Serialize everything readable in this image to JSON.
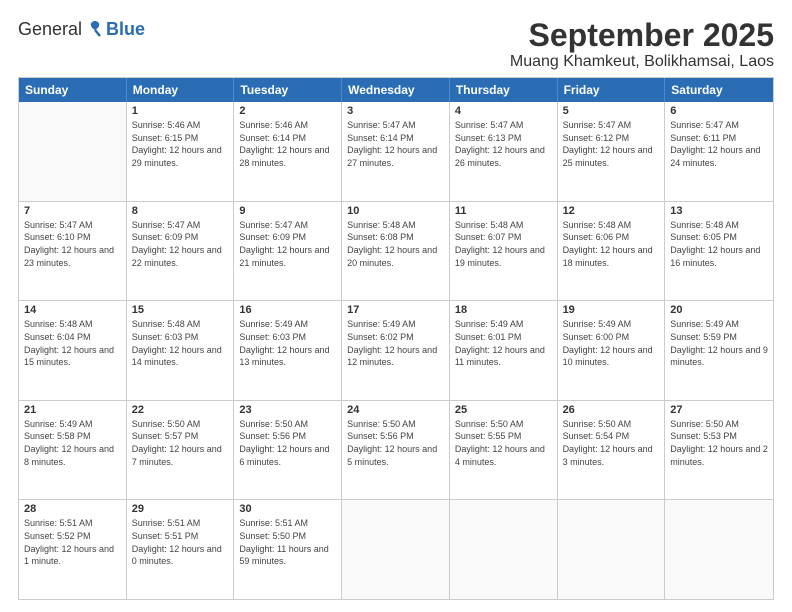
{
  "app": {
    "logo_general": "General",
    "logo_blue": "Blue"
  },
  "title": "September 2025",
  "subtitle": "Muang Khamkeut, Bolikhamsai, Laos",
  "days": [
    "Sunday",
    "Monday",
    "Tuesday",
    "Wednesday",
    "Thursday",
    "Friday",
    "Saturday"
  ],
  "weeks": [
    [
      {
        "day": "",
        "sunrise": "",
        "sunset": "",
        "daylight": ""
      },
      {
        "day": "1",
        "sunrise": "Sunrise: 5:46 AM",
        "sunset": "Sunset: 6:15 PM",
        "daylight": "Daylight: 12 hours and 29 minutes."
      },
      {
        "day": "2",
        "sunrise": "Sunrise: 5:46 AM",
        "sunset": "Sunset: 6:14 PM",
        "daylight": "Daylight: 12 hours and 28 minutes."
      },
      {
        "day": "3",
        "sunrise": "Sunrise: 5:47 AM",
        "sunset": "Sunset: 6:14 PM",
        "daylight": "Daylight: 12 hours and 27 minutes."
      },
      {
        "day": "4",
        "sunrise": "Sunrise: 5:47 AM",
        "sunset": "Sunset: 6:13 PM",
        "daylight": "Daylight: 12 hours and 26 minutes."
      },
      {
        "day": "5",
        "sunrise": "Sunrise: 5:47 AM",
        "sunset": "Sunset: 6:12 PM",
        "daylight": "Daylight: 12 hours and 25 minutes."
      },
      {
        "day": "6",
        "sunrise": "Sunrise: 5:47 AM",
        "sunset": "Sunset: 6:11 PM",
        "daylight": "Daylight: 12 hours and 24 minutes."
      }
    ],
    [
      {
        "day": "7",
        "sunrise": "Sunrise: 5:47 AM",
        "sunset": "Sunset: 6:10 PM",
        "daylight": "Daylight: 12 hours and 23 minutes."
      },
      {
        "day": "8",
        "sunrise": "Sunrise: 5:47 AM",
        "sunset": "Sunset: 6:09 PM",
        "daylight": "Daylight: 12 hours and 22 minutes."
      },
      {
        "day": "9",
        "sunrise": "Sunrise: 5:47 AM",
        "sunset": "Sunset: 6:09 PM",
        "daylight": "Daylight: 12 hours and 21 minutes."
      },
      {
        "day": "10",
        "sunrise": "Sunrise: 5:48 AM",
        "sunset": "Sunset: 6:08 PM",
        "daylight": "Daylight: 12 hours and 20 minutes."
      },
      {
        "day": "11",
        "sunrise": "Sunrise: 5:48 AM",
        "sunset": "Sunset: 6:07 PM",
        "daylight": "Daylight: 12 hours and 19 minutes."
      },
      {
        "day": "12",
        "sunrise": "Sunrise: 5:48 AM",
        "sunset": "Sunset: 6:06 PM",
        "daylight": "Daylight: 12 hours and 18 minutes."
      },
      {
        "day": "13",
        "sunrise": "Sunrise: 5:48 AM",
        "sunset": "Sunset: 6:05 PM",
        "daylight": "Daylight: 12 hours and 16 minutes."
      }
    ],
    [
      {
        "day": "14",
        "sunrise": "Sunrise: 5:48 AM",
        "sunset": "Sunset: 6:04 PM",
        "daylight": "Daylight: 12 hours and 15 minutes."
      },
      {
        "day": "15",
        "sunrise": "Sunrise: 5:48 AM",
        "sunset": "Sunset: 6:03 PM",
        "daylight": "Daylight: 12 hours and 14 minutes."
      },
      {
        "day": "16",
        "sunrise": "Sunrise: 5:49 AM",
        "sunset": "Sunset: 6:03 PM",
        "daylight": "Daylight: 12 hours and 13 minutes."
      },
      {
        "day": "17",
        "sunrise": "Sunrise: 5:49 AM",
        "sunset": "Sunset: 6:02 PM",
        "daylight": "Daylight: 12 hours and 12 minutes."
      },
      {
        "day": "18",
        "sunrise": "Sunrise: 5:49 AM",
        "sunset": "Sunset: 6:01 PM",
        "daylight": "Daylight: 12 hours and 11 minutes."
      },
      {
        "day": "19",
        "sunrise": "Sunrise: 5:49 AM",
        "sunset": "Sunset: 6:00 PM",
        "daylight": "Daylight: 12 hours and 10 minutes."
      },
      {
        "day": "20",
        "sunrise": "Sunrise: 5:49 AM",
        "sunset": "Sunset: 5:59 PM",
        "daylight": "Daylight: 12 hours and 9 minutes."
      }
    ],
    [
      {
        "day": "21",
        "sunrise": "Sunrise: 5:49 AM",
        "sunset": "Sunset: 5:58 PM",
        "daylight": "Daylight: 12 hours and 8 minutes."
      },
      {
        "day": "22",
        "sunrise": "Sunrise: 5:50 AM",
        "sunset": "Sunset: 5:57 PM",
        "daylight": "Daylight: 12 hours and 7 minutes."
      },
      {
        "day": "23",
        "sunrise": "Sunrise: 5:50 AM",
        "sunset": "Sunset: 5:56 PM",
        "daylight": "Daylight: 12 hours and 6 minutes."
      },
      {
        "day": "24",
        "sunrise": "Sunrise: 5:50 AM",
        "sunset": "Sunset: 5:56 PM",
        "daylight": "Daylight: 12 hours and 5 minutes."
      },
      {
        "day": "25",
        "sunrise": "Sunrise: 5:50 AM",
        "sunset": "Sunset: 5:55 PM",
        "daylight": "Daylight: 12 hours and 4 minutes."
      },
      {
        "day": "26",
        "sunrise": "Sunrise: 5:50 AM",
        "sunset": "Sunset: 5:54 PM",
        "daylight": "Daylight: 12 hours and 3 minutes."
      },
      {
        "day": "27",
        "sunrise": "Sunrise: 5:50 AM",
        "sunset": "Sunset: 5:53 PM",
        "daylight": "Daylight: 12 hours and 2 minutes."
      }
    ],
    [
      {
        "day": "28",
        "sunrise": "Sunrise: 5:51 AM",
        "sunset": "Sunset: 5:52 PM",
        "daylight": "Daylight: 12 hours and 1 minute."
      },
      {
        "day": "29",
        "sunrise": "Sunrise: 5:51 AM",
        "sunset": "Sunset: 5:51 PM",
        "daylight": "Daylight: 12 hours and 0 minutes."
      },
      {
        "day": "30",
        "sunrise": "Sunrise: 5:51 AM",
        "sunset": "Sunset: 5:50 PM",
        "daylight": "Daylight: 11 hours and 59 minutes."
      },
      {
        "day": "",
        "sunrise": "",
        "sunset": "",
        "daylight": ""
      },
      {
        "day": "",
        "sunrise": "",
        "sunset": "",
        "daylight": ""
      },
      {
        "day": "",
        "sunrise": "",
        "sunset": "",
        "daylight": ""
      },
      {
        "day": "",
        "sunrise": "",
        "sunset": "",
        "daylight": ""
      }
    ]
  ]
}
